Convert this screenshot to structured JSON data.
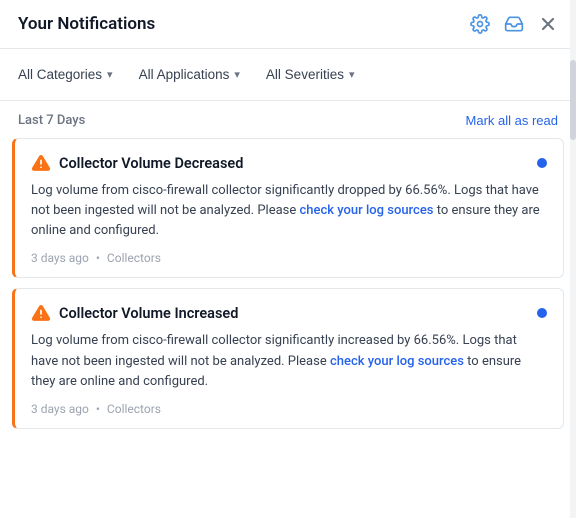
{
  "header": {
    "title": "Your Notifications",
    "icons": {
      "settings": "gear-icon",
      "inbox": "inbox-icon",
      "close": "close-icon"
    }
  },
  "filters": [
    {
      "label": "All Categories",
      "key": "all-categories"
    },
    {
      "label": "All Applications",
      "key": "all-applications"
    },
    {
      "label": "All Severities",
      "key": "all-severities"
    }
  ],
  "section": {
    "label": "Last 7 Days",
    "mark_all_read": "Mark all as read"
  },
  "notifications": [
    {
      "id": "n1",
      "title": "Collector Volume Decreased",
      "body_prefix": "Log volume from cisco-firewall collector significantly dropped by 66.56%. Logs that have not been ingested will not be analyzed. Please ",
      "link_text": "check your log sources",
      "body_suffix": " to ensure they are online and configured.",
      "time": "3 days ago",
      "category": "Collectors",
      "unread": true
    },
    {
      "id": "n2",
      "title": "Collector Volume Increased",
      "body_prefix": "Log volume from cisco-firewall collector significantly increased by 66.56%. Logs that have not been ingested will not be analyzed. Please ",
      "link_text": "check your log sources",
      "body_suffix": " to ensure they are online and configured.",
      "time": "3 days ago",
      "category": "Collectors",
      "unread": true
    }
  ],
  "colors": {
    "accent_blue": "#2563eb",
    "warning_orange": "#f97316",
    "unread_dot": "#2563eb"
  }
}
